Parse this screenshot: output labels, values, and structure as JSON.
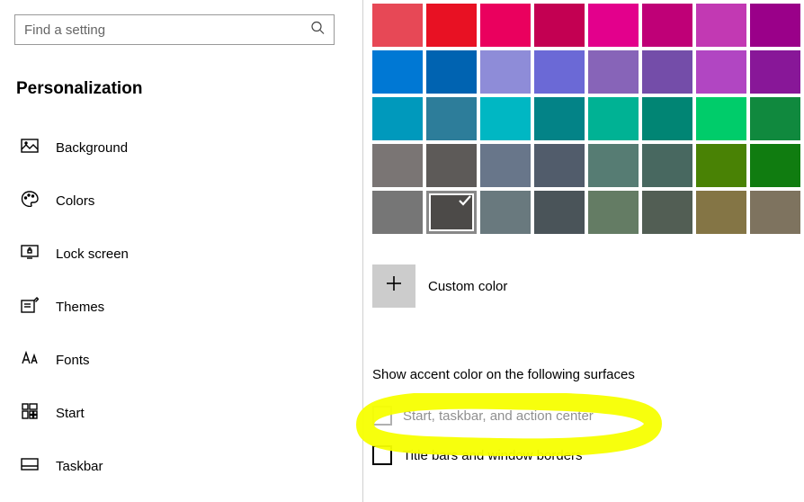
{
  "search": {
    "placeholder": "Find a setting"
  },
  "section_title": "Personalization",
  "nav": [
    {
      "name": "background",
      "label": "Background"
    },
    {
      "name": "colors",
      "label": "Colors"
    },
    {
      "name": "lockscreen",
      "label": "Lock screen"
    },
    {
      "name": "themes",
      "label": "Themes"
    },
    {
      "name": "fonts",
      "label": "Fonts"
    },
    {
      "name": "start",
      "label": "Start"
    },
    {
      "name": "taskbar",
      "label": "Taskbar"
    }
  ],
  "colors_grid": [
    [
      "#e74856",
      "#e81123",
      "#ea005e",
      "#c30052",
      "#e3008c",
      "#bf0077",
      "#c239b3",
      "#9a0089"
    ],
    [
      "#0078d4",
      "#0063b1",
      "#8e8cd8",
      "#6b69d6",
      "#8764b8",
      "#744da9",
      "#b146c2",
      "#881798"
    ],
    [
      "#0099bc",
      "#2d7d9a",
      "#00b7c3",
      "#038387",
      "#00b294",
      "#018574",
      "#00cc6a",
      "#10893e"
    ],
    [
      "#7a7574",
      "#5d5a58",
      "#68768a",
      "#515c6b",
      "#567c73",
      "#486860",
      "#498205",
      "#107c10"
    ],
    [
      "#767676",
      "#4c4a48",
      "#69797e",
      "#4a5459",
      "#647c64",
      "#525e54",
      "#847545",
      "#7e735f"
    ]
  ],
  "selected_color": {
    "row": 4,
    "col": 1
  },
  "custom_color_label": "Custom color",
  "accent_section_label": "Show accent color on the following surfaces",
  "checkbox_start": {
    "label": "Start, taskbar, and action center",
    "disabled": true
  },
  "checkbox_title": {
    "label": "Title bars and window borders",
    "disabled": false
  }
}
